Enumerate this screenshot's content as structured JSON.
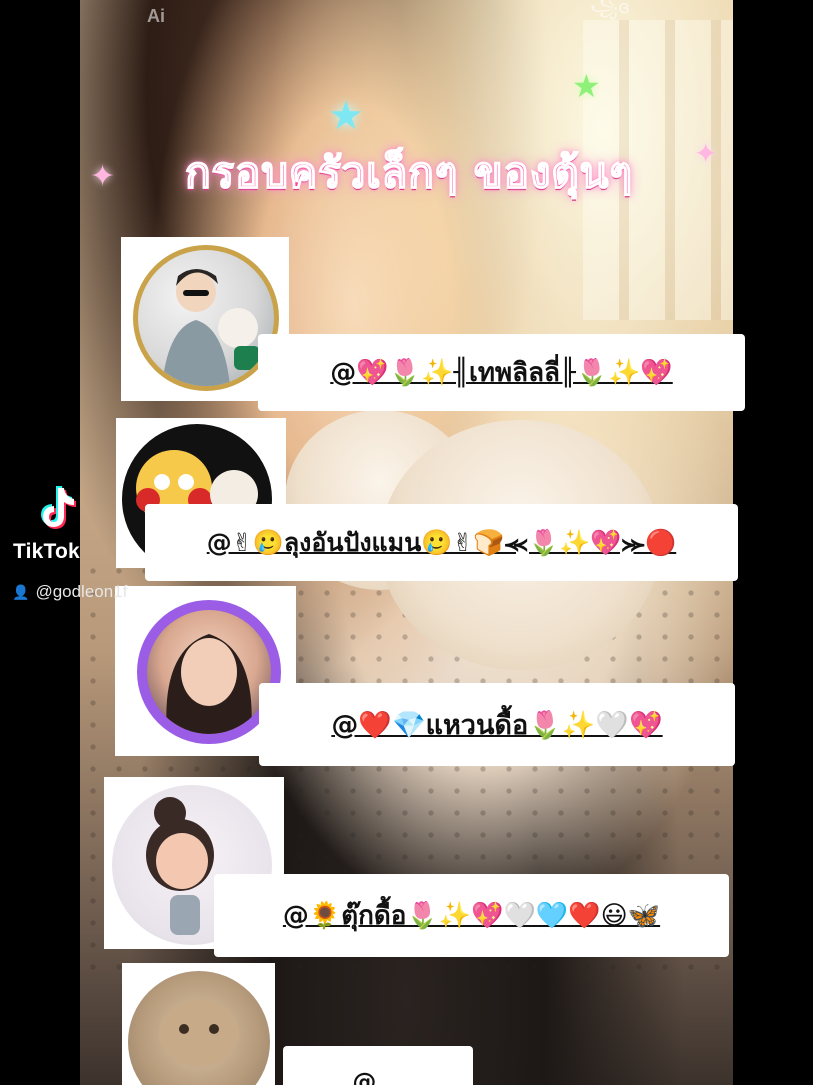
{
  "watermarks": {
    "ai": "Ai",
    "tiktok_word": "TikTok",
    "tiktok_user": "@godleon1f",
    "top_corner": "꧁ɞ"
  },
  "title": "กรอบครัวเล็กๆ ของตุ้นๆ",
  "members": [
    {
      "name": "@💖🌷✨╢เทพลิลลี่╟🌷✨💖",
      "avatar": "avatar-man-with-cat"
    },
    {
      "name": "@✌🥲ลุงอันปังแมน🥲✌🍞⪻🌷✨💖⪼🔴",
      "avatar": "avatar-cartoon-face"
    },
    {
      "name": "@❤️💎แหวนดื้อ🌷✨🤍💖",
      "avatar": "avatar-girl-purple-frame"
    },
    {
      "name": "@🌻ตุ๊กดื้อ🌷✨💖🤍🩵❤️😃🦋",
      "avatar": "avatar-cartoon-girl"
    },
    {
      "name": "@...",
      "avatar": "avatar-cat-photo"
    }
  ],
  "colors": {
    "title_pink": "#ff3f9a",
    "card_bg": "#ffffff",
    "tiktok_cyan": "#25f4ee",
    "tiktok_red": "#fe2c55"
  }
}
